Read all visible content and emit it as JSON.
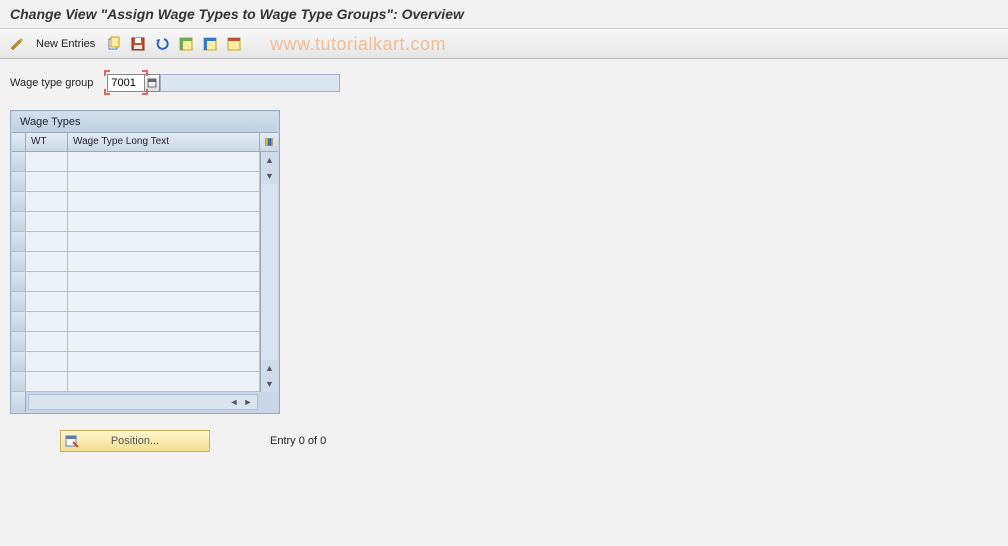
{
  "title": "Change View \"Assign Wage Types to Wage Type Groups\": Overview",
  "toolbar": {
    "new_entries_label": "New Entries"
  },
  "watermark": "www.tutorialkart.com",
  "form": {
    "wage_type_group_label": "Wage type group",
    "wage_type_group_value": "7001",
    "wage_type_group_desc": ""
  },
  "table": {
    "title": "Wage Types",
    "columns": {
      "wt": "WT",
      "long_text": "Wage Type Long Text"
    },
    "rows": [
      {
        "wt": "",
        "text": ""
      },
      {
        "wt": "",
        "text": ""
      },
      {
        "wt": "",
        "text": ""
      },
      {
        "wt": "",
        "text": ""
      },
      {
        "wt": "",
        "text": ""
      },
      {
        "wt": "",
        "text": ""
      },
      {
        "wt": "",
        "text": ""
      },
      {
        "wt": "",
        "text": ""
      },
      {
        "wt": "",
        "text": ""
      },
      {
        "wt": "",
        "text": ""
      },
      {
        "wt": "",
        "text": ""
      },
      {
        "wt": "",
        "text": ""
      }
    ]
  },
  "footer": {
    "position_label": "Position...",
    "entry_text": "Entry 0 of 0"
  }
}
